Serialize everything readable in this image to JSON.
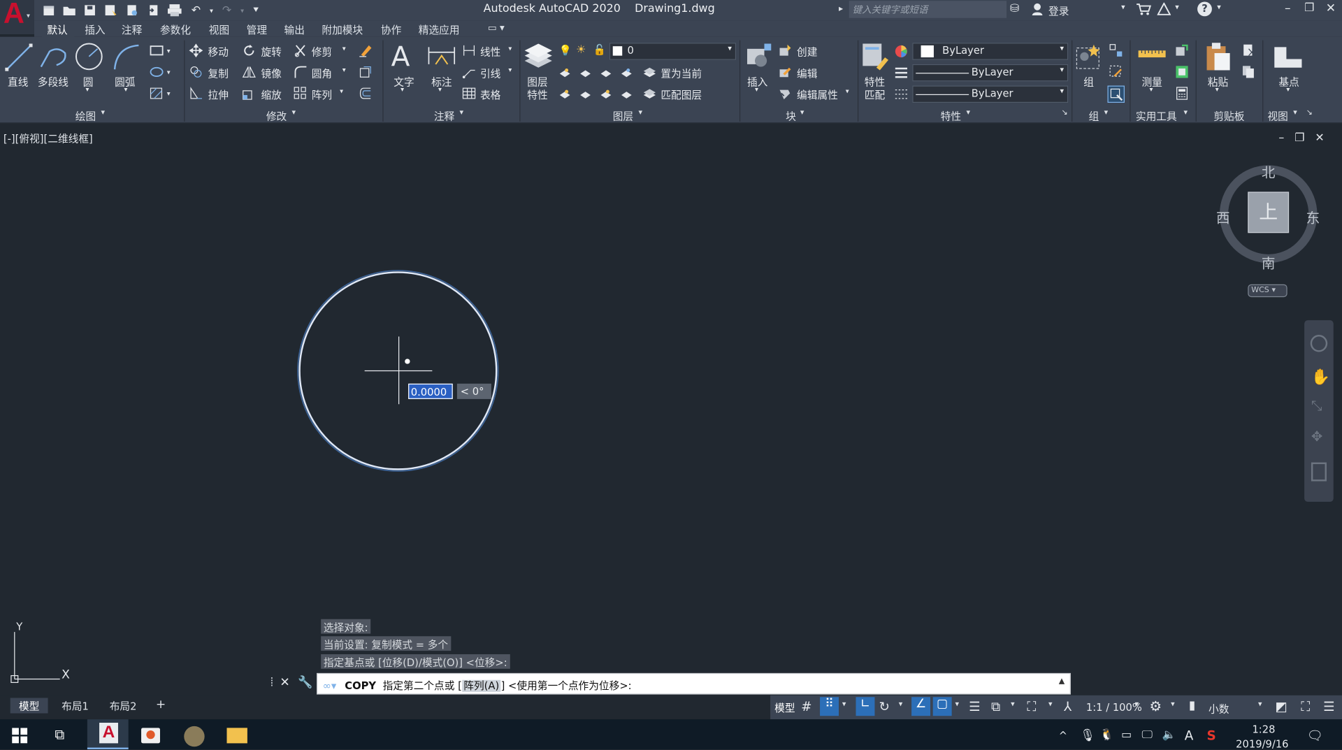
{
  "app": {
    "title": "Autodesk AutoCAD 2020    Drawing1.dwg",
    "search_placeholder": "键入关键字或短语",
    "login": "登录",
    "help_icon": "?",
    "brand_color": "#c8102e"
  },
  "tabs": [
    "默认",
    "插入",
    "注释",
    "参数化",
    "视图",
    "管理",
    "输出",
    "附加模块",
    "协作",
    "精选应用"
  ],
  "ribbon": {
    "draw": {
      "line": "直线",
      "polyline": "多段线",
      "circle": "圆",
      "arc": "圆弧",
      "footer": "绘图"
    },
    "modify": {
      "move": "移动",
      "rotate": "旋转",
      "trim": "修剪",
      "copy": "复制",
      "mirror": "镜像",
      "fillet": "圆角",
      "stretch": "拉伸",
      "scale": "缩放",
      "array": "阵列",
      "footer": "修改"
    },
    "annotation": {
      "text": "文字",
      "dimension": "标注",
      "linear": "线性",
      "leader": "引线",
      "table": "表格",
      "footer": "注释"
    },
    "layers": {
      "props": "图层",
      "props2": "特性",
      "current_layer": "0",
      "make_current": "置为当前",
      "match_layer": "匹配图层",
      "footer": "图层"
    },
    "block": {
      "insert": "插入",
      "create": "创建",
      "edit": "编辑",
      "edit_attr": "编辑属性",
      "footer": "块"
    },
    "properties": {
      "match": "特性",
      "match2": "匹配",
      "color": "ByLayer",
      "linetype": "ByLayer",
      "lineweight": "ByLayer",
      "footer": "特性"
    },
    "groups": {
      "group": "组",
      "footer": "组"
    },
    "utilities": {
      "measure": "测量",
      "footer": "实用工具"
    },
    "clipboard": {
      "paste": "粘贴",
      "footer": "剪贴板"
    },
    "view": {
      "base": "基点",
      "footer": "视图"
    }
  },
  "viewport": {
    "label": "[-][俯视][二维线框]",
    "compass": {
      "north": "北",
      "south": "南",
      "east": "东",
      "west": "西",
      "top": "上"
    },
    "wcs": "WCS",
    "dyn_value": "0.0000",
    "dyn_angle": "< 0°",
    "ucs_x": "X",
    "ucs_y": "Y"
  },
  "command": {
    "history": [
      "选择对象:",
      "当前设置:  复制模式 = 多个",
      "指定基点或 [位移(D)/模式(O)] <位移>:"
    ],
    "name": "COPY",
    "prompt": "指定第二个点或 [",
    "option": "阵列(A)",
    "prompt_end": "] <使用第一个点作为位移>:"
  },
  "layouts": [
    "模型",
    "布局1",
    "布局2"
  ],
  "statusbar": {
    "model": "模型",
    "scale": "1:1 / 100%",
    "units": "小数"
  },
  "taskbar": {
    "time": "1:28",
    "date": "2019/9/16"
  }
}
